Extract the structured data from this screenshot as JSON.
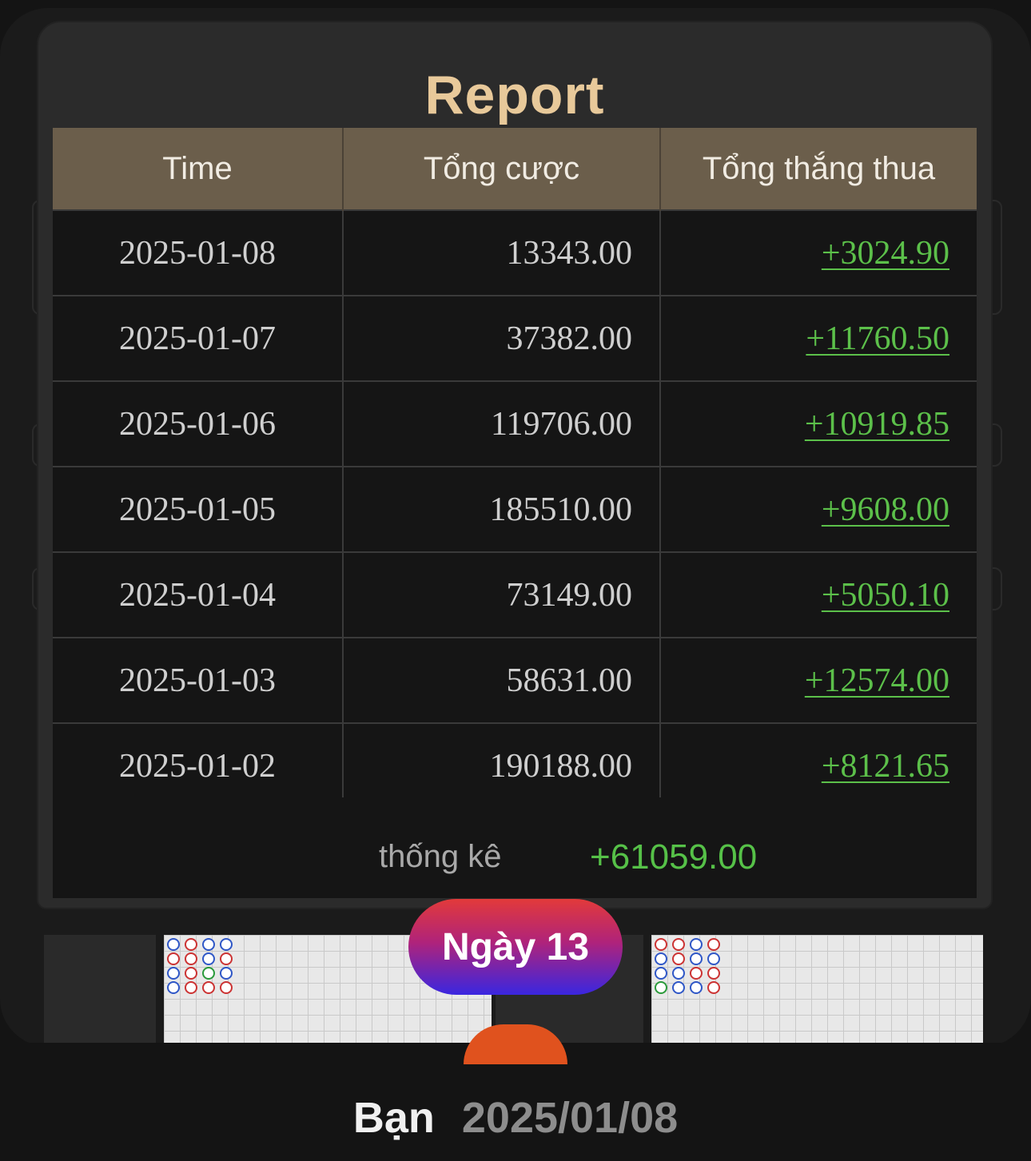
{
  "modal": {
    "title": "Report",
    "columns": [
      "Time",
      "Tổng cược",
      "Tổng thắng thua"
    ],
    "rows": [
      {
        "time": "2025-01-08",
        "bet": "13343.00",
        "pl": "+3024.90"
      },
      {
        "time": "2025-01-07",
        "bet": "37382.00",
        "pl": "+11760.50"
      },
      {
        "time": "2025-01-06",
        "bet": "119706.00",
        "pl": "+10919.85"
      },
      {
        "time": "2025-01-05",
        "bet": "185510.00",
        "pl": "+9608.00"
      },
      {
        "time": "2025-01-04",
        "bet": "73149.00",
        "pl": "+5050.10"
      },
      {
        "time": "2025-01-03",
        "bet": "58631.00",
        "pl": "+12574.00"
      },
      {
        "time": "2025-01-02",
        "bet": "190188.00",
        "pl": "+8121.65"
      }
    ],
    "summary_label": "thống kê",
    "summary_value": "+61059.00"
  },
  "badge": {
    "label": "Ngày 13"
  },
  "footer": {
    "who": "Bạn",
    "date": "2025/01/08"
  },
  "colors": {
    "title": "#e8c99a",
    "header_bg": "#6b5e4b",
    "positive": "#5cc04a",
    "badge_top": "#e23a3a",
    "badge_bottom": "#3a26e0"
  }
}
